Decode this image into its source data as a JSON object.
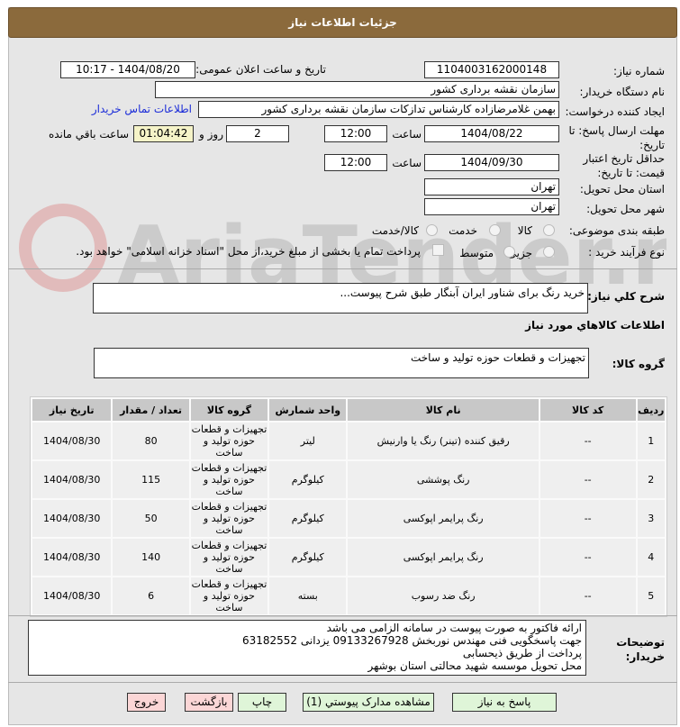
{
  "header": {
    "title": "جزئیات اطلاعات نیاز"
  },
  "form": {
    "need_number_label": "شماره نیاز:",
    "need_number": "1104003162000148",
    "announce_label": "تاریخ و ساعت اعلان عمومی:",
    "announce_value": "1404/08/20 - 10:17",
    "buyer_org_label": "نام دستگاه خریدار:",
    "buyer_org": "سازمان نقشه برداری کشور",
    "creator_label": "ایجاد کننده درخواست:",
    "creator": "بهمن غلامرضازاده کارشناس تدازکات  سازمان نقشه برداری کشور",
    "contact_link": "اطلاعات تماس خریدار",
    "deadline_label": "مهلت ارسال پاسخ: تا تاریخ:",
    "deadline_date": "1404/08/22",
    "time_label": "ساعت",
    "deadline_time": "12:00",
    "days": "2",
    "days_label": "روز و",
    "remaining": "01:04:42",
    "remaining_label": "ساعت باقي مانده",
    "validity_label": "حداقل تاریخ اعتبار قیمت: تا تاریخ:",
    "validity_date": "1404/09/30",
    "validity_time": "12:00",
    "province_label": "استان محل تحویل:",
    "province": "تهران",
    "city_label": "شهر محل تحویل:",
    "city": "تهران",
    "category_label": "طبقه بندی موضوعی:",
    "category_options": [
      "کالا",
      "خدمت",
      "کالا/خدمت"
    ],
    "category_selected": "کالا",
    "process_label": "نوع فرآیند خرید :",
    "process_options": [
      "جزیی",
      "متوسط"
    ],
    "process_selected": "جزیی",
    "payment_note": "پرداخت تمام یا بخشی از مبلغ خرید،از محل \"اسناد خزانه اسلامی\" خواهد بود."
  },
  "summary": {
    "label": "شرح کلي نیاز:",
    "value": "خرید رنگ برای شناور ایران آبنگار طبق شرح پیوست..."
  },
  "goods": {
    "section_title": "اطلاعات کالاهاي مورد نیاز",
    "group_label": "گروه کالا:",
    "group_value": "تجهیزات و قطعات حوزه تولید و ساخت"
  },
  "table": {
    "headers": [
      "ردیف",
      "کد کالا",
      "نام کالا",
      "واحد شمارش",
      "گروه کالا",
      "تعداد / مقدار",
      "تاریخ نیاز"
    ],
    "rows": [
      [
        "1",
        "--",
        "رقیق کننده (تینر) رنگ یا وارنیش",
        "لیتر",
        "تجهیزات و قطعات حوزه تولید و ساخت",
        "80",
        "1404/08/30"
      ],
      [
        "2",
        "--",
        "رنگ پوششی",
        "کیلوگرم",
        "تجهیزات و قطعات حوزه تولید و ساخت",
        "115",
        "1404/08/30"
      ],
      [
        "3",
        "--",
        "رنگ پرایمر اپوکسی",
        "کیلوگرم",
        "تجهیزات و قطعات حوزه تولید و ساخت",
        "50",
        "1404/08/30"
      ],
      [
        "4",
        "--",
        "رنگ پرایمر اپوکسی",
        "کیلوگرم",
        "تجهیزات و قطعات حوزه تولید و ساخت",
        "140",
        "1404/08/30"
      ],
      [
        "5",
        "--",
        "رنگ ضد رسوب",
        "بسته",
        "تجهیزات و قطعات حوزه تولید و ساخت",
        "6",
        "1404/08/30"
      ]
    ]
  },
  "notes": {
    "label": "توضیحات خریدار:",
    "lines": [
      "ارائه فاکتور به صورت پیوست در سامانه  الزامی می باشد",
      " جهت پاسخگویی فنی مهندس نوربخش 09133267928 یزدانی 63182552",
      "پرداخت از طریق ذیحسابی",
      "محل تحویل موسسه شهید محالتی استان بوشهر"
    ]
  },
  "buttons": {
    "reply": "پاسخ به نیاز",
    "docs": "مشاهده مدارک پیوستي (1)",
    "print": "چاپ",
    "back": "بازگشت",
    "exit": "خروج"
  },
  "watermark": "AriaTender.net",
  "colors": {
    "header": "#8b6a3c",
    "link": "#1a2bd8",
    "green_button": "#dff5d8",
    "red_button": "#fbd6d6"
  }
}
